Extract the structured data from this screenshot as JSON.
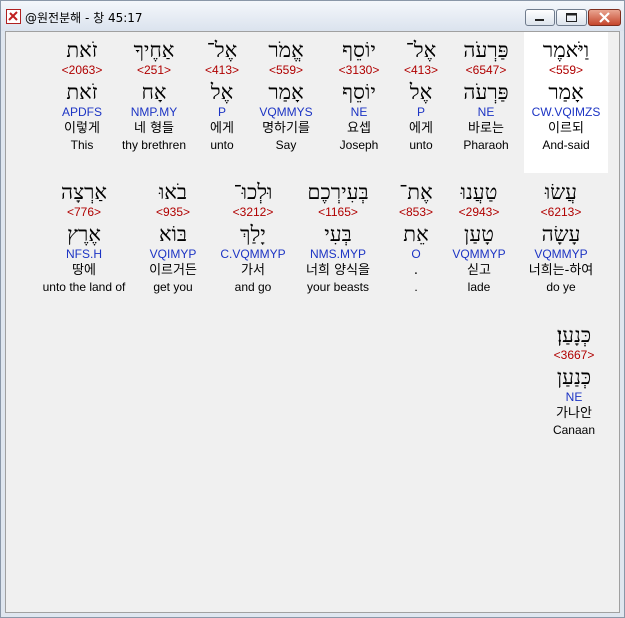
{
  "window": {
    "title": "@원전분해 - 창 45:17"
  },
  "words": [
    {
      "heb1": "וַיֹּאמֶר",
      "num": "<559>",
      "heb2": "אָמַר",
      "morph": "CW.VQIMZS",
      "kor": "이르되",
      "eng": "And-said"
    },
    {
      "heb1": "פַּרְעֹה",
      "num": "<6547>",
      "heb2": "פַּרְעֹה",
      "morph": "NE",
      "kor": "바로는",
      "eng": "Pharaoh"
    },
    {
      "heb1": "אֶל־",
      "num": "<413>",
      "heb2": "אֶל",
      "morph": "P",
      "kor": "에게",
      "eng": "unto"
    },
    {
      "heb1": "יוֹסֵף",
      "num": "<3130>",
      "heb2": "יוֹסֵף",
      "morph": "NE",
      "kor": "요셉",
      "eng": "Joseph"
    },
    {
      "heb1": "אֱמֹר",
      "num": "<559>",
      "heb2": "אָמַר",
      "morph": "VQMMYS",
      "kor": "명하기를",
      "eng": "Say"
    },
    {
      "heb1": "אֶל־",
      "num": "<413>",
      "heb2": "אֶל",
      "morph": "P",
      "kor": "에게",
      "eng": "unto"
    },
    {
      "heb1": "אַחֶיךָ",
      "num": "<251>",
      "heb2": "אָח",
      "morph": "NMP.MY",
      "kor": "네 형들",
      "eng": "thy brethren"
    },
    {
      "heb1": "זֹאת",
      "num": "<2063>",
      "heb2": "זֹאת",
      "morph": "APDFS",
      "kor": "이렇게",
      "eng": "This"
    },
    {
      "heb1": "עֲשׂוּ",
      "num": "<6213>",
      "heb2": "עָשָׂה",
      "morph": "VQMMYP",
      "kor": "너희는-하여",
      "eng": "do ye"
    },
    {
      "heb1": "טַעֲנוּ",
      "num": "<2943>",
      "heb2": "טָעַן",
      "morph": "VQMMYP",
      "kor": "싣고",
      "eng": "lade"
    },
    {
      "heb1": "אֶת־",
      "num": "<853>",
      "heb2": "אֵת",
      "morph": "O",
      "kor": ".",
      "eng": "."
    },
    {
      "heb1": "בְּעִירְכֶם",
      "num": "<1165>",
      "heb2": "בְּעִי",
      "morph": "NMS.MYP",
      "kor": "너희 양식을",
      "eng": "your beasts"
    },
    {
      "heb1": "וּלְכוּ־",
      "num": "<3212>",
      "heb2": "יָלַךְ",
      "morph": "C.VQMMYP",
      "kor": "가서",
      "eng": "and go"
    },
    {
      "heb1": "בֹאוּ",
      "num": "<935>",
      "heb2": "בּוֹא",
      "morph": "VQIMYP",
      "kor": "이르거든",
      "eng": "get you"
    },
    {
      "heb1": "אַרְצָה",
      "num": "<776>",
      "heb2": "אֶרֶץ",
      "morph": "NFS.H",
      "kor": "땅에",
      "eng": "unto the land of"
    },
    {
      "heb1": "כְּנָעַן׃",
      "num": "<3667>",
      "heb2": "כְּנַעַן",
      "morph": "NE",
      "kor": "가나안",
      "eng": "Canaan"
    }
  ]
}
